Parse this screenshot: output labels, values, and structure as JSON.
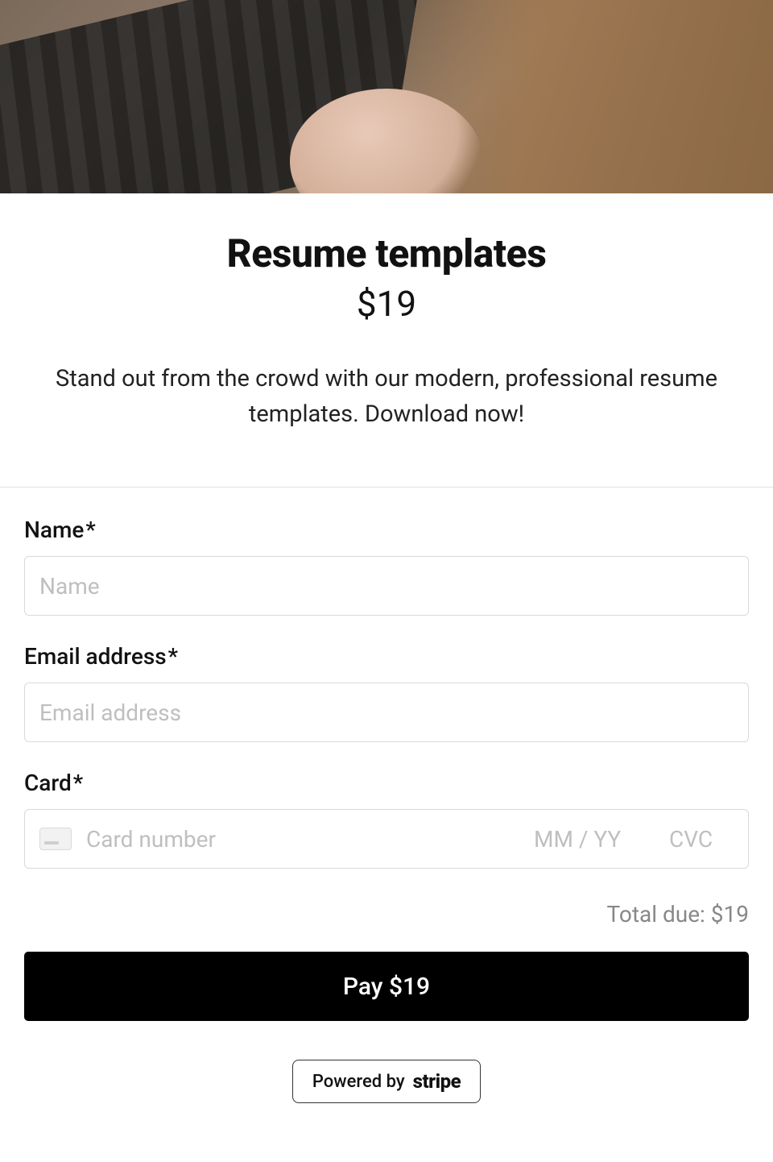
{
  "product": {
    "title": "Resume templates",
    "price": "$19",
    "description": "Stand out from the crowd with our modern, professional resume templates. Download now!"
  },
  "form": {
    "name": {
      "label": "Name",
      "required_mark": "*",
      "placeholder": "Name",
      "value": ""
    },
    "email": {
      "label": "Email address",
      "required_mark": "*",
      "placeholder": "Email address",
      "value": ""
    },
    "card": {
      "label": "Card",
      "required_mark": "*",
      "number_placeholder": "Card number",
      "expiry_placeholder": "MM / YY",
      "cvc_placeholder": "CVC"
    },
    "total_label": "Total due: $19",
    "pay_button_label": "Pay $19"
  },
  "footer": {
    "powered_by": "Powered by",
    "brand": "stripe"
  }
}
